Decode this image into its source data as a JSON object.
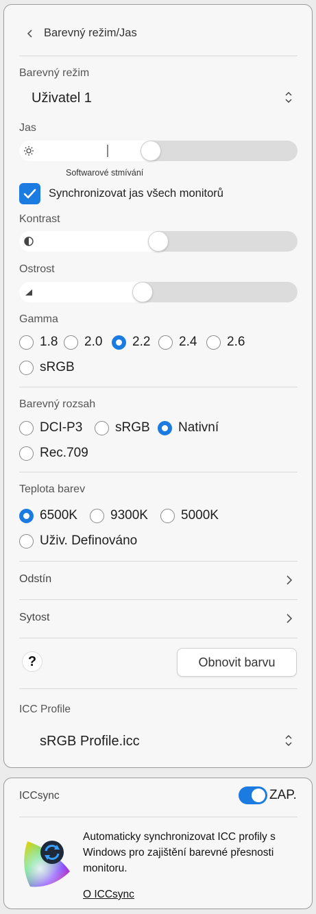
{
  "header": {
    "title": "Barevný režim/Jas",
    "back_icon": "chevron-left-icon"
  },
  "color_mode": {
    "label": "Barevný režim",
    "value": "Uživatel 1"
  },
  "brightness": {
    "label": "Jas",
    "level": 0.47,
    "software_dim_marker": 0.315,
    "software_dim_label": "Softwarové stmívání",
    "icon": "sun-icon"
  },
  "sync": {
    "label": "Synchronizovat jas všech monitorů",
    "checked": true
  },
  "contrast": {
    "label": "Kontrast",
    "level": 0.5,
    "icon": "contrast-icon"
  },
  "sharpness": {
    "label": "Ostrost",
    "level": 0.44,
    "icon": "sharpness-icon"
  },
  "gamma": {
    "label": "Gamma",
    "options": [
      "1.8",
      "2.0",
      "2.2",
      "2.4",
      "2.6",
      "sRGB"
    ],
    "selected": "2.2"
  },
  "gamut": {
    "label": "Barevný rozsah",
    "options": [
      "DCI-P3",
      "sRGB",
      "Nativní",
      "Rec.709"
    ],
    "selected": "Nativní"
  },
  "color_temp": {
    "label": "Teplota barev",
    "options": [
      "6500K",
      "9300K",
      "5000K",
      "Uživ. Definováno"
    ],
    "selected": "6500K"
  },
  "hue": {
    "label": "Odstín"
  },
  "saturation": {
    "label": "Sytost"
  },
  "help": {
    "label": "?"
  },
  "reset_button": {
    "label": "Obnovit barvu"
  },
  "icc_profile": {
    "label": "ICC Profile",
    "value": "sRGB Profile.icc"
  },
  "iccsync": {
    "title": "ICCsync",
    "toggle_on": true,
    "toggle_label": "ZAP.",
    "description": "Automaticky synchronizovat ICC profily s Windows pro zajištění barevné přesnosti monitoru.",
    "link": "O ICCsync"
  },
  "colors": {
    "accent": "#1c7be0",
    "track": "#dcdcdc",
    "panel": "#f7f7f7"
  }
}
